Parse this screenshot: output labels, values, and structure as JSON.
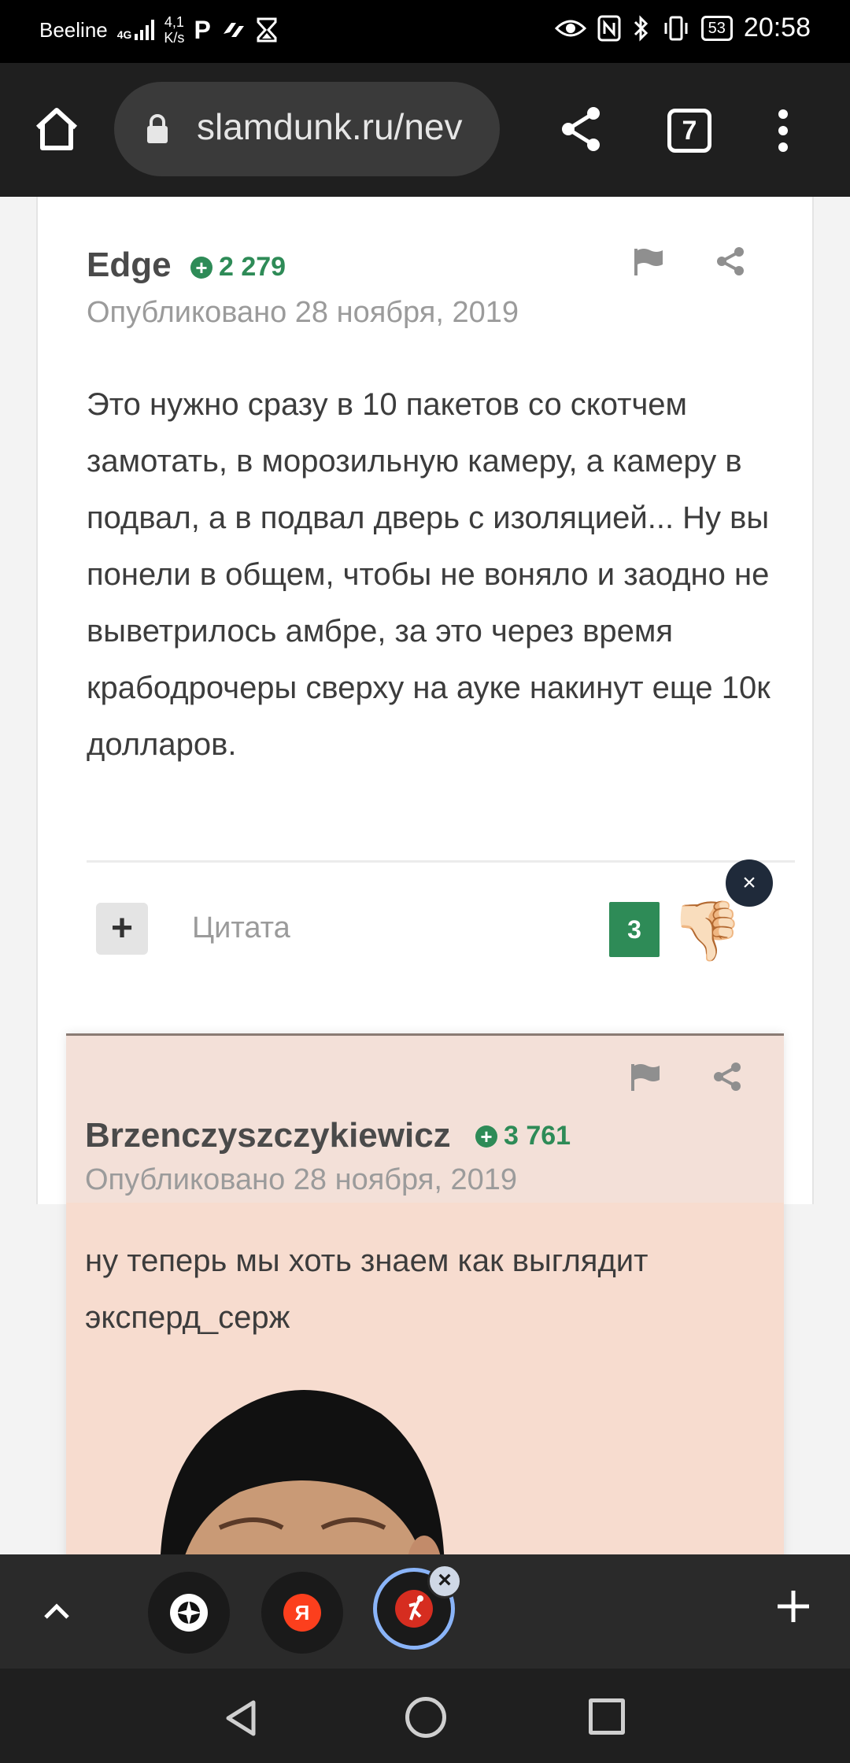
{
  "status_bar": {
    "carrier": "Beeline",
    "network": "4G",
    "speed": "4,1\nK/s",
    "battery": "53",
    "time": "20:58"
  },
  "browser": {
    "url": "slamdunk.ru/nev",
    "tab_count": "7"
  },
  "posts": [
    {
      "author": "Edge",
      "reputation": "2 279",
      "date": "Опубликовано 28 ноября, 2019",
      "text": "Это нужно сразу в 10 пакетов со скотчем замотать, в морозильную камеру, а камеру в подвал, а в подвал дверь с изоляцией... Ну вы понели в общем, чтобы не воняло и заодно не выветрилось  амбре, за это через время крабодрочеры сверху на ауке накинут еще 10к долларов.",
      "quote_label": "Цитата",
      "vote_count": "3",
      "vote_emoji": "👎🏻",
      "vote_close": "×",
      "quote_plus": "+"
    },
    {
      "author": "Brzenczyszczykiewicz",
      "reputation": "3 761",
      "date": "Опубликовано 28 ноября, 2019",
      "text": "ну теперь мы хоть знаем как выглядит эксперд_серж"
    }
  ],
  "tabstrip": {
    "tab_close": "×"
  },
  "colors": {
    "reputation_green": "#2e8b57",
    "highlighted_post_bg": "#f7dccf",
    "toolbar_bg": "#1f1f1f"
  }
}
